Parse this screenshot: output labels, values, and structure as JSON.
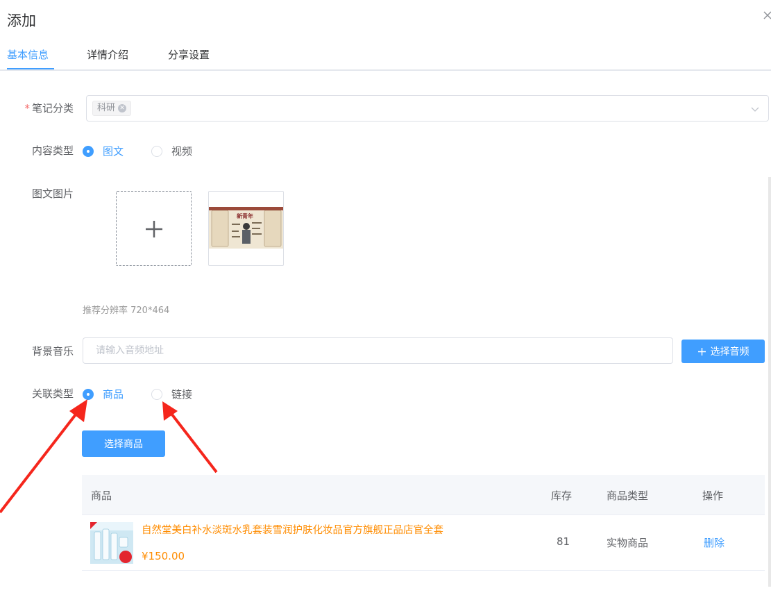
{
  "dialog": {
    "title": "添加"
  },
  "tabs": [
    {
      "label": "基本信息",
      "active": true
    },
    {
      "label": "详情介绍",
      "active": false
    },
    {
      "label": "分享设置",
      "active": false
    }
  ],
  "form": {
    "category": {
      "required_mark": "*",
      "label": "笔记分类",
      "selected_tag": "科研"
    },
    "content_type": {
      "label": "内容类型",
      "options": [
        "图文",
        "视频"
      ],
      "selected": "图文"
    },
    "images": {
      "label": "图文图片",
      "hint": "推荐分辨率 720*464"
    },
    "music": {
      "label": "背景音乐",
      "placeholder": "请输入音频地址",
      "button_label": "选择音频"
    },
    "link_type": {
      "label": "关联类型",
      "options": [
        "商品",
        "链接"
      ],
      "selected": "商品"
    },
    "select_product_button": "选择商品"
  },
  "product_table": {
    "columns": [
      "商品",
      "库存",
      "商品类型",
      "操作"
    ],
    "rows": [
      {
        "name": "自然堂美白补水淡斑水乳套装雪润护肤化妆品官方旗舰正品店官全套",
        "price": "¥150.00",
        "stock": "81",
        "type": "实物商品",
        "action": "删除"
      }
    ]
  },
  "colors": {
    "primary": "#409eff",
    "price": "#ff8c00",
    "annotation_arrow": "#f5261c"
  }
}
